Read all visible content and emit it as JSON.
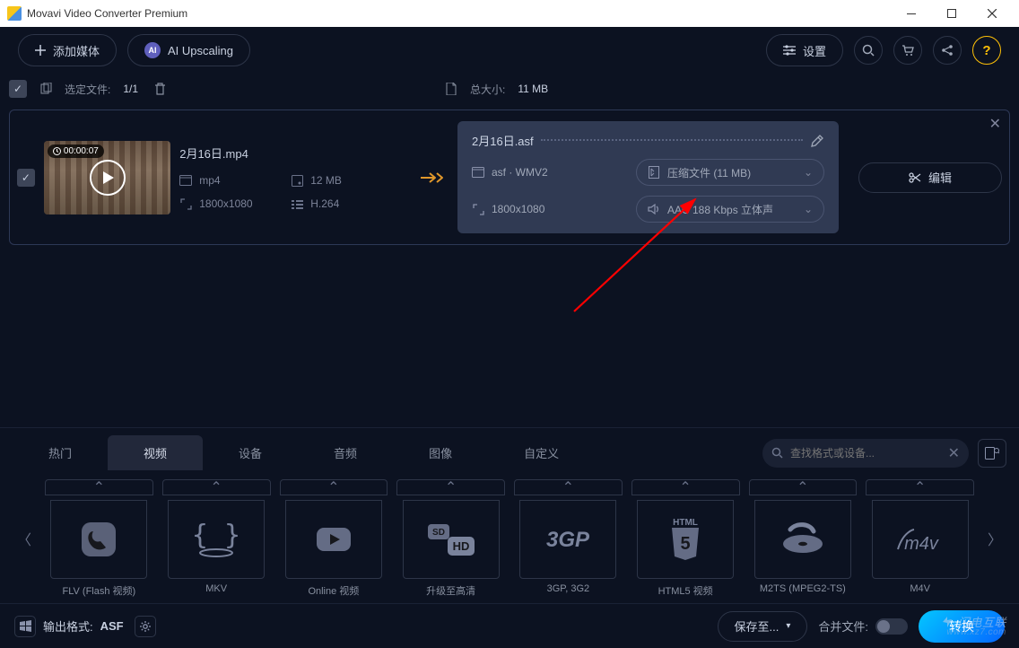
{
  "window": {
    "title": "Movavi Video Converter Premium"
  },
  "toolbar": {
    "add_media": "添加媒体",
    "ai_upscaling": "AI Upscaling",
    "settings": "设置"
  },
  "selectbar": {
    "selected_label": "选定文件:",
    "selected_count": "1/1",
    "total_size_label": "总大小:",
    "total_size": "11 MB"
  },
  "item": {
    "duration": "00:00:07",
    "src": {
      "filename": "2月16日.mp4",
      "container": "mp4",
      "size": "12 MB",
      "resolution": "1800x1080",
      "codec": "H.264"
    },
    "dst": {
      "filename": "2月16日.asf",
      "container": "asf · WMV2",
      "resolution": "1800x1080",
      "compress": "压缩文件 (11 MB)",
      "audio": "AAC 188 Kbps 立体声"
    },
    "edit_label": "编辑"
  },
  "tabs": {
    "items": [
      "热门",
      "视频",
      "设备",
      "音频",
      "图像",
      "自定义"
    ],
    "active_index": 1,
    "search_placeholder": "查找格式或设备..."
  },
  "formats": {
    "items": [
      {
        "label": "FLV (Flash 视频)"
      },
      {
        "label": "MKV"
      },
      {
        "label": "Online 视频"
      },
      {
        "label": "升级至高清"
      },
      {
        "label": "3GP, 3G2"
      },
      {
        "label": "HTML5 视频"
      },
      {
        "label": "M2TS (MPEG2-TS)"
      },
      {
        "label": "M4V"
      }
    ]
  },
  "footer": {
    "output_format_label": "输出格式:",
    "output_format_value": "ASF",
    "save_to": "保存至...",
    "merge": "合并文件:",
    "convert": "转换"
  },
  "watermark": {
    "brand": "闪电互联",
    "url": "www.xz7.com"
  }
}
